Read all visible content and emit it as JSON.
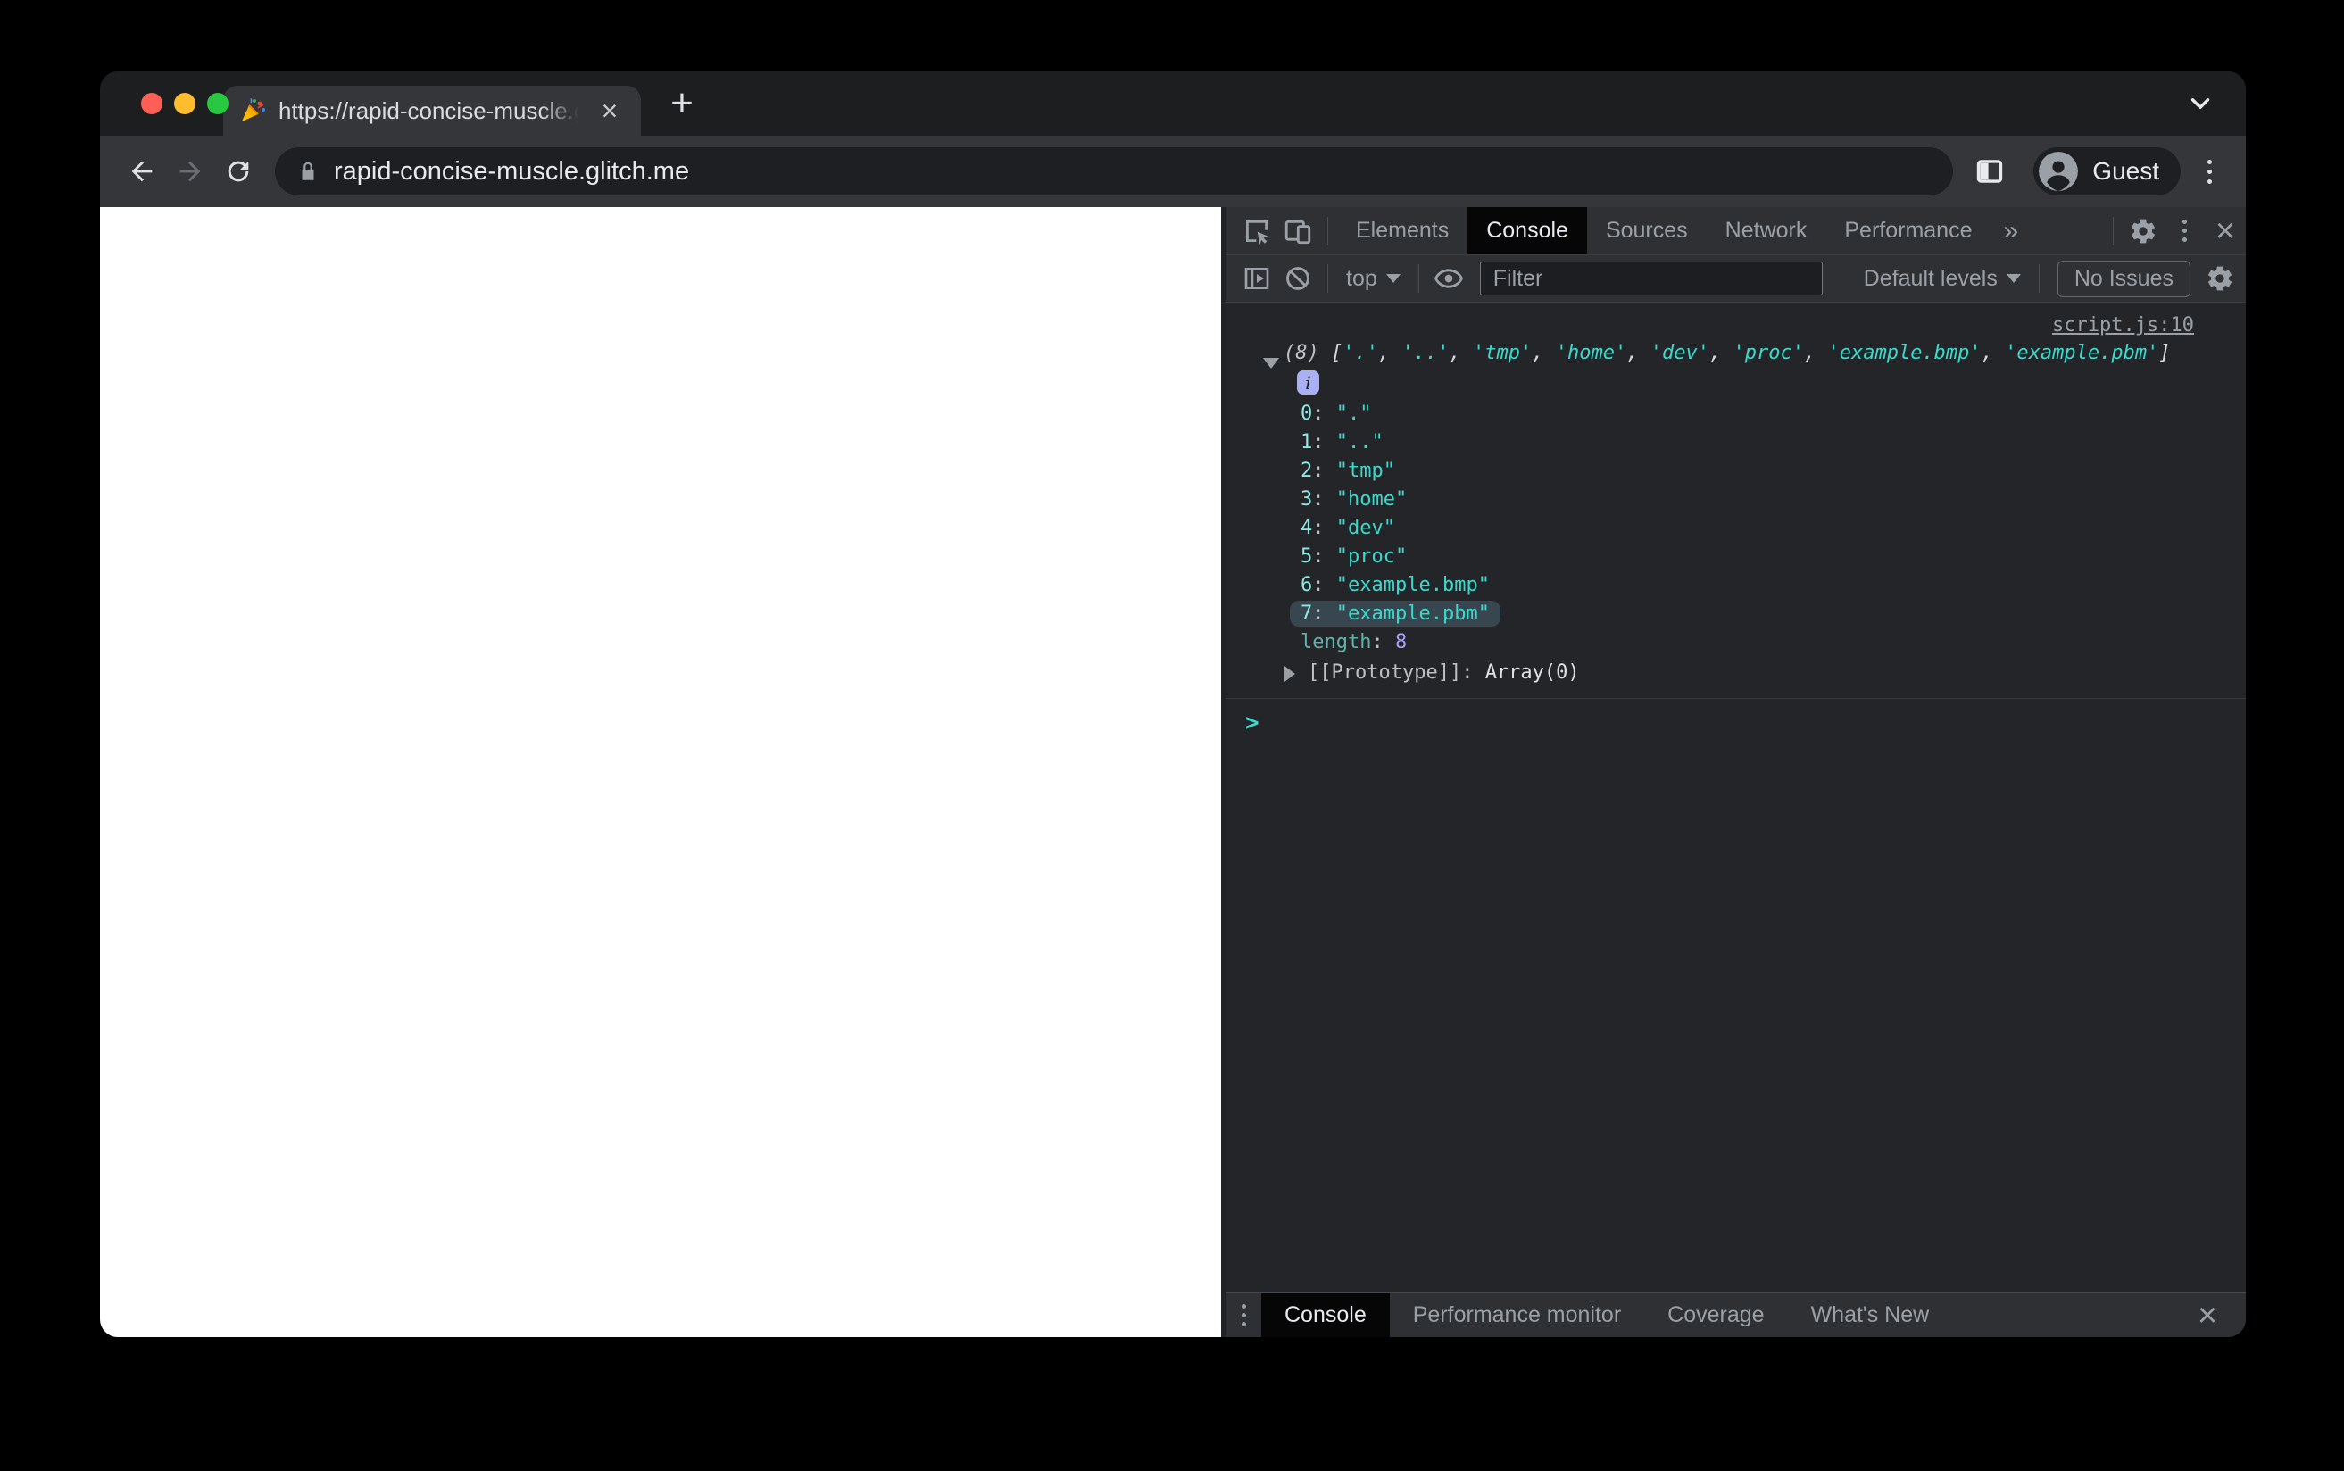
{
  "browser": {
    "tab": {
      "title": "https://rapid-concise-muscle.g",
      "close_glyph": "×",
      "new_tab_glyph": "+"
    },
    "toolbar": {
      "url": "rapid-concise-muscle.glitch.me",
      "profile_label": "Guest"
    },
    "traffic_lights": {
      "close": "#FF5F57",
      "minimize": "#FEBC2E",
      "zoom": "#28C840"
    }
  },
  "devtools": {
    "tabs": [
      "Elements",
      "Console",
      "Sources",
      "Network",
      "Performance"
    ],
    "active_tab": "Console",
    "more_tabs_glyph": "»",
    "close_glyph": "×",
    "console_toolbar": {
      "context_label": "top",
      "filter_placeholder": "Filter",
      "levels_label": "Default levels",
      "issues_label": "No Issues"
    },
    "console": {
      "source_link": "script.js:10",
      "preview_prefix": "(8)",
      "preview_items": [
        ".",
        "..",
        "tmp",
        "home",
        "dev",
        "proc",
        "example.bmp",
        "example.pbm"
      ],
      "entries": [
        {
          "index": "0",
          "value": "."
        },
        {
          "index": "1",
          "value": ".."
        },
        {
          "index": "2",
          "value": "tmp"
        },
        {
          "index": "3",
          "value": "home"
        },
        {
          "index": "4",
          "value": "dev"
        },
        {
          "index": "5",
          "value": "proc"
        },
        {
          "index": "6",
          "value": "example.bmp"
        },
        {
          "index": "7",
          "value": "example.pbm"
        }
      ],
      "highlighted_index": 7,
      "length_label": "length",
      "length_value": "8",
      "prototype_label": "[[Prototype]]",
      "prototype_value": "Array(0)",
      "prompt_glyph": ">"
    },
    "drawer": {
      "tabs": [
        "Console",
        "Performance monitor",
        "Coverage",
        "What's New"
      ],
      "active_tab": "Console",
      "close_glyph": "×"
    }
  },
  "colors": {
    "accent_teal": "#3AD9CC",
    "index_teal": "#8FE8E0",
    "number_lavender": "#A9A2F6",
    "info_badge": "#A9B1F4",
    "highlight_row": "#37464F",
    "chrome_bg": "#35363A",
    "devtools_bg": "#242528"
  }
}
